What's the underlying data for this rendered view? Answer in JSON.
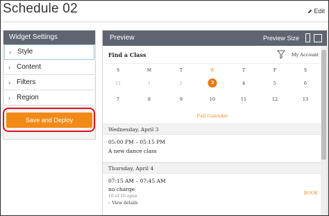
{
  "page": {
    "title": "Schedule 02",
    "edit_label": "Edit"
  },
  "settings": {
    "header": "Widget Settings",
    "items": [
      {
        "label": "Style"
      },
      {
        "label": "Content"
      },
      {
        "label": "Filters"
      },
      {
        "label": "Region"
      }
    ],
    "deploy_label": "Save and Deploy"
  },
  "preview": {
    "header": "Preview",
    "size_label": "Preview Size",
    "find_title": "Find a Class",
    "my_account": "My Account",
    "calendar": {
      "days_of_week": [
        "S",
        "M",
        "T",
        "W",
        "T",
        "F",
        "S"
      ],
      "accent_dow_index": 3,
      "weeks": [
        [
          "11",
          "1",
          "2",
          "3",
          "4",
          "5",
          "6"
        ],
        [
          "7",
          "8",
          "9",
          "10",
          "11",
          "12",
          "13"
        ]
      ],
      "dim_cells": [
        [
          0,
          0
        ],
        [
          0,
          1
        ],
        [
          0,
          2
        ]
      ],
      "today": [
        0,
        3
      ],
      "full_calendar_label": "Full Calendar"
    },
    "days": [
      {
        "header": "Wednesday, April 3",
        "sessions": [
          {
            "time": "05:00 PM – 05:15 PM",
            "name": "A new dance class"
          }
        ]
      },
      {
        "header": "Thursday, April 4",
        "sessions": [
          {
            "time": "07:15 AM – 07:45 AM",
            "name": "no charge",
            "spots": "10 of 10 open",
            "details": "View details",
            "book": "BOOK"
          }
        ]
      }
    ]
  },
  "colors": {
    "accent": "#f28a18",
    "header_bg": "#5f6470",
    "highlight_ring": "#e0101a"
  }
}
